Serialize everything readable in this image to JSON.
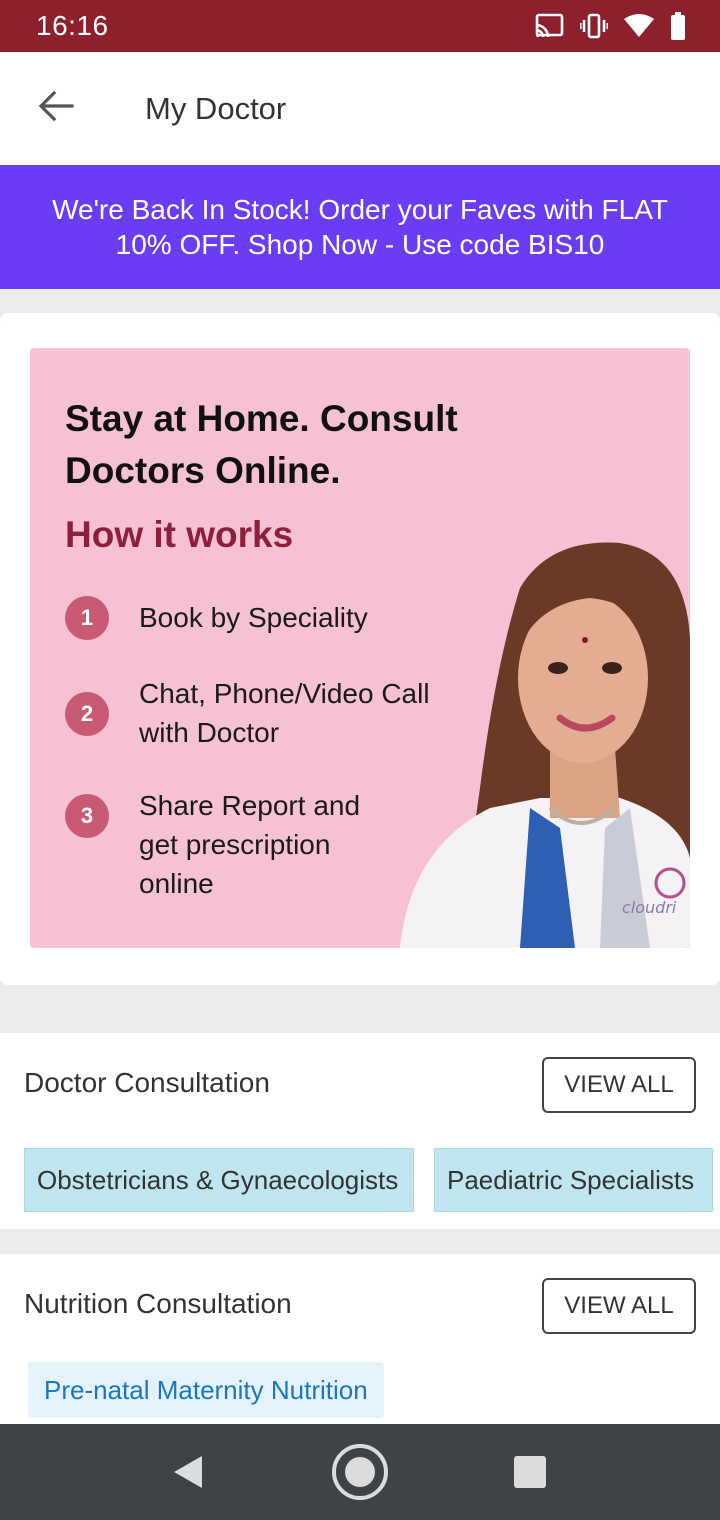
{
  "status_bar": {
    "time": "16:16",
    "icons": [
      "cast-icon",
      "vibrate-icon",
      "wifi-icon",
      "battery-icon"
    ]
  },
  "app_bar": {
    "title": "My Doctor",
    "back_icon": "arrow-back-icon"
  },
  "promo": {
    "text": "We're Back In Stock! Order your Faves with FLAT 10% OFF. Shop Now - Use code BIS10",
    "bg_color": "#6a3df5"
  },
  "hero": {
    "headline": "Stay at Home. Consult Doctors Online.",
    "subheading": "How it works",
    "steps": [
      {
        "num": "1",
        "text": "Book by Speciality"
      },
      {
        "num": "2",
        "text": "Chat, Phone/Video Call with Doctor"
      },
      {
        "num": "3",
        "text": "Share Report and get prescription online"
      }
    ],
    "watermark": "cloudri"
  },
  "doctor_consultation": {
    "title": "Doctor Consultation",
    "view_all": "VIEW ALL",
    "chips": [
      "Obstetricians & Gynaecologists",
      "Paediatric Specialists"
    ]
  },
  "nutrition_consultation": {
    "title": "Nutrition Consultation",
    "view_all": "VIEW ALL",
    "chips": [
      "Pre-natal Maternity Nutrition"
    ]
  },
  "colors": {
    "status_bar": "#8e1f2c",
    "accent": "#6a3df5",
    "chip_blue": "#bfe6ef",
    "link_blue": "#1b76bf"
  }
}
